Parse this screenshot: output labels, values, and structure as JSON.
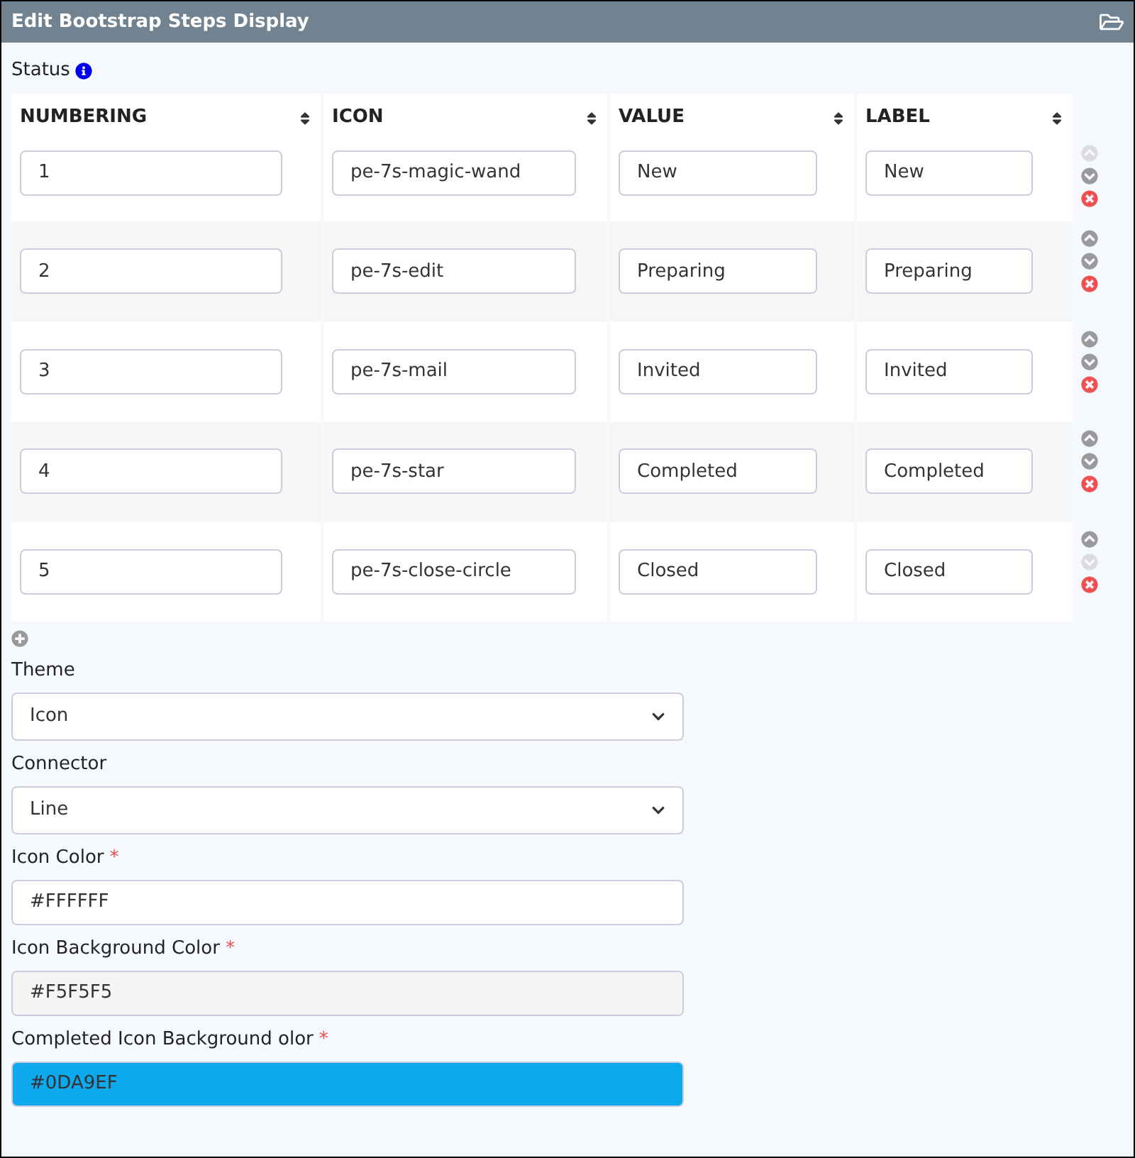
{
  "window": {
    "title": "Edit Bootstrap Steps Display"
  },
  "status": {
    "label": "Status"
  },
  "table": {
    "columns": [
      "NUMBERING",
      "ICON",
      "VALUE",
      "LABEL"
    ],
    "rows": [
      {
        "cells": [
          "1",
          "pe-7s-magic-wand",
          "New",
          "New"
        ],
        "up_disabled": true,
        "down_disabled": false
      },
      {
        "cells": [
          "2",
          "pe-7s-edit",
          "Preparing",
          "Preparing"
        ],
        "up_disabled": false,
        "down_disabled": false
      },
      {
        "cells": [
          "3",
          "pe-7s-mail",
          "Invited",
          "Invited"
        ],
        "up_disabled": false,
        "down_disabled": false
      },
      {
        "cells": [
          "4",
          "pe-7s-star",
          "Completed",
          "Completed"
        ],
        "up_disabled": false,
        "down_disabled": false
      },
      {
        "cells": [
          "5",
          "pe-7s-close-circle",
          "Closed",
          "Closed"
        ],
        "up_disabled": false,
        "down_disabled": true
      }
    ]
  },
  "fields": [
    {
      "kind": "select",
      "label": "Theme",
      "value": "Icon"
    },
    {
      "kind": "select",
      "label": "Connector",
      "value": "Line"
    },
    {
      "kind": "color",
      "label": "Icon Color",
      "required_mark": "*",
      "value": "#FFFFFF"
    },
    {
      "kind": "color",
      "label": "Icon Background Color",
      "required_mark": "*",
      "value": "#F5F5F5"
    },
    {
      "kind": "color",
      "label": "Completed Icon Background olor",
      "required_mark": "*",
      "value": "#0DA9EF"
    }
  ]
}
